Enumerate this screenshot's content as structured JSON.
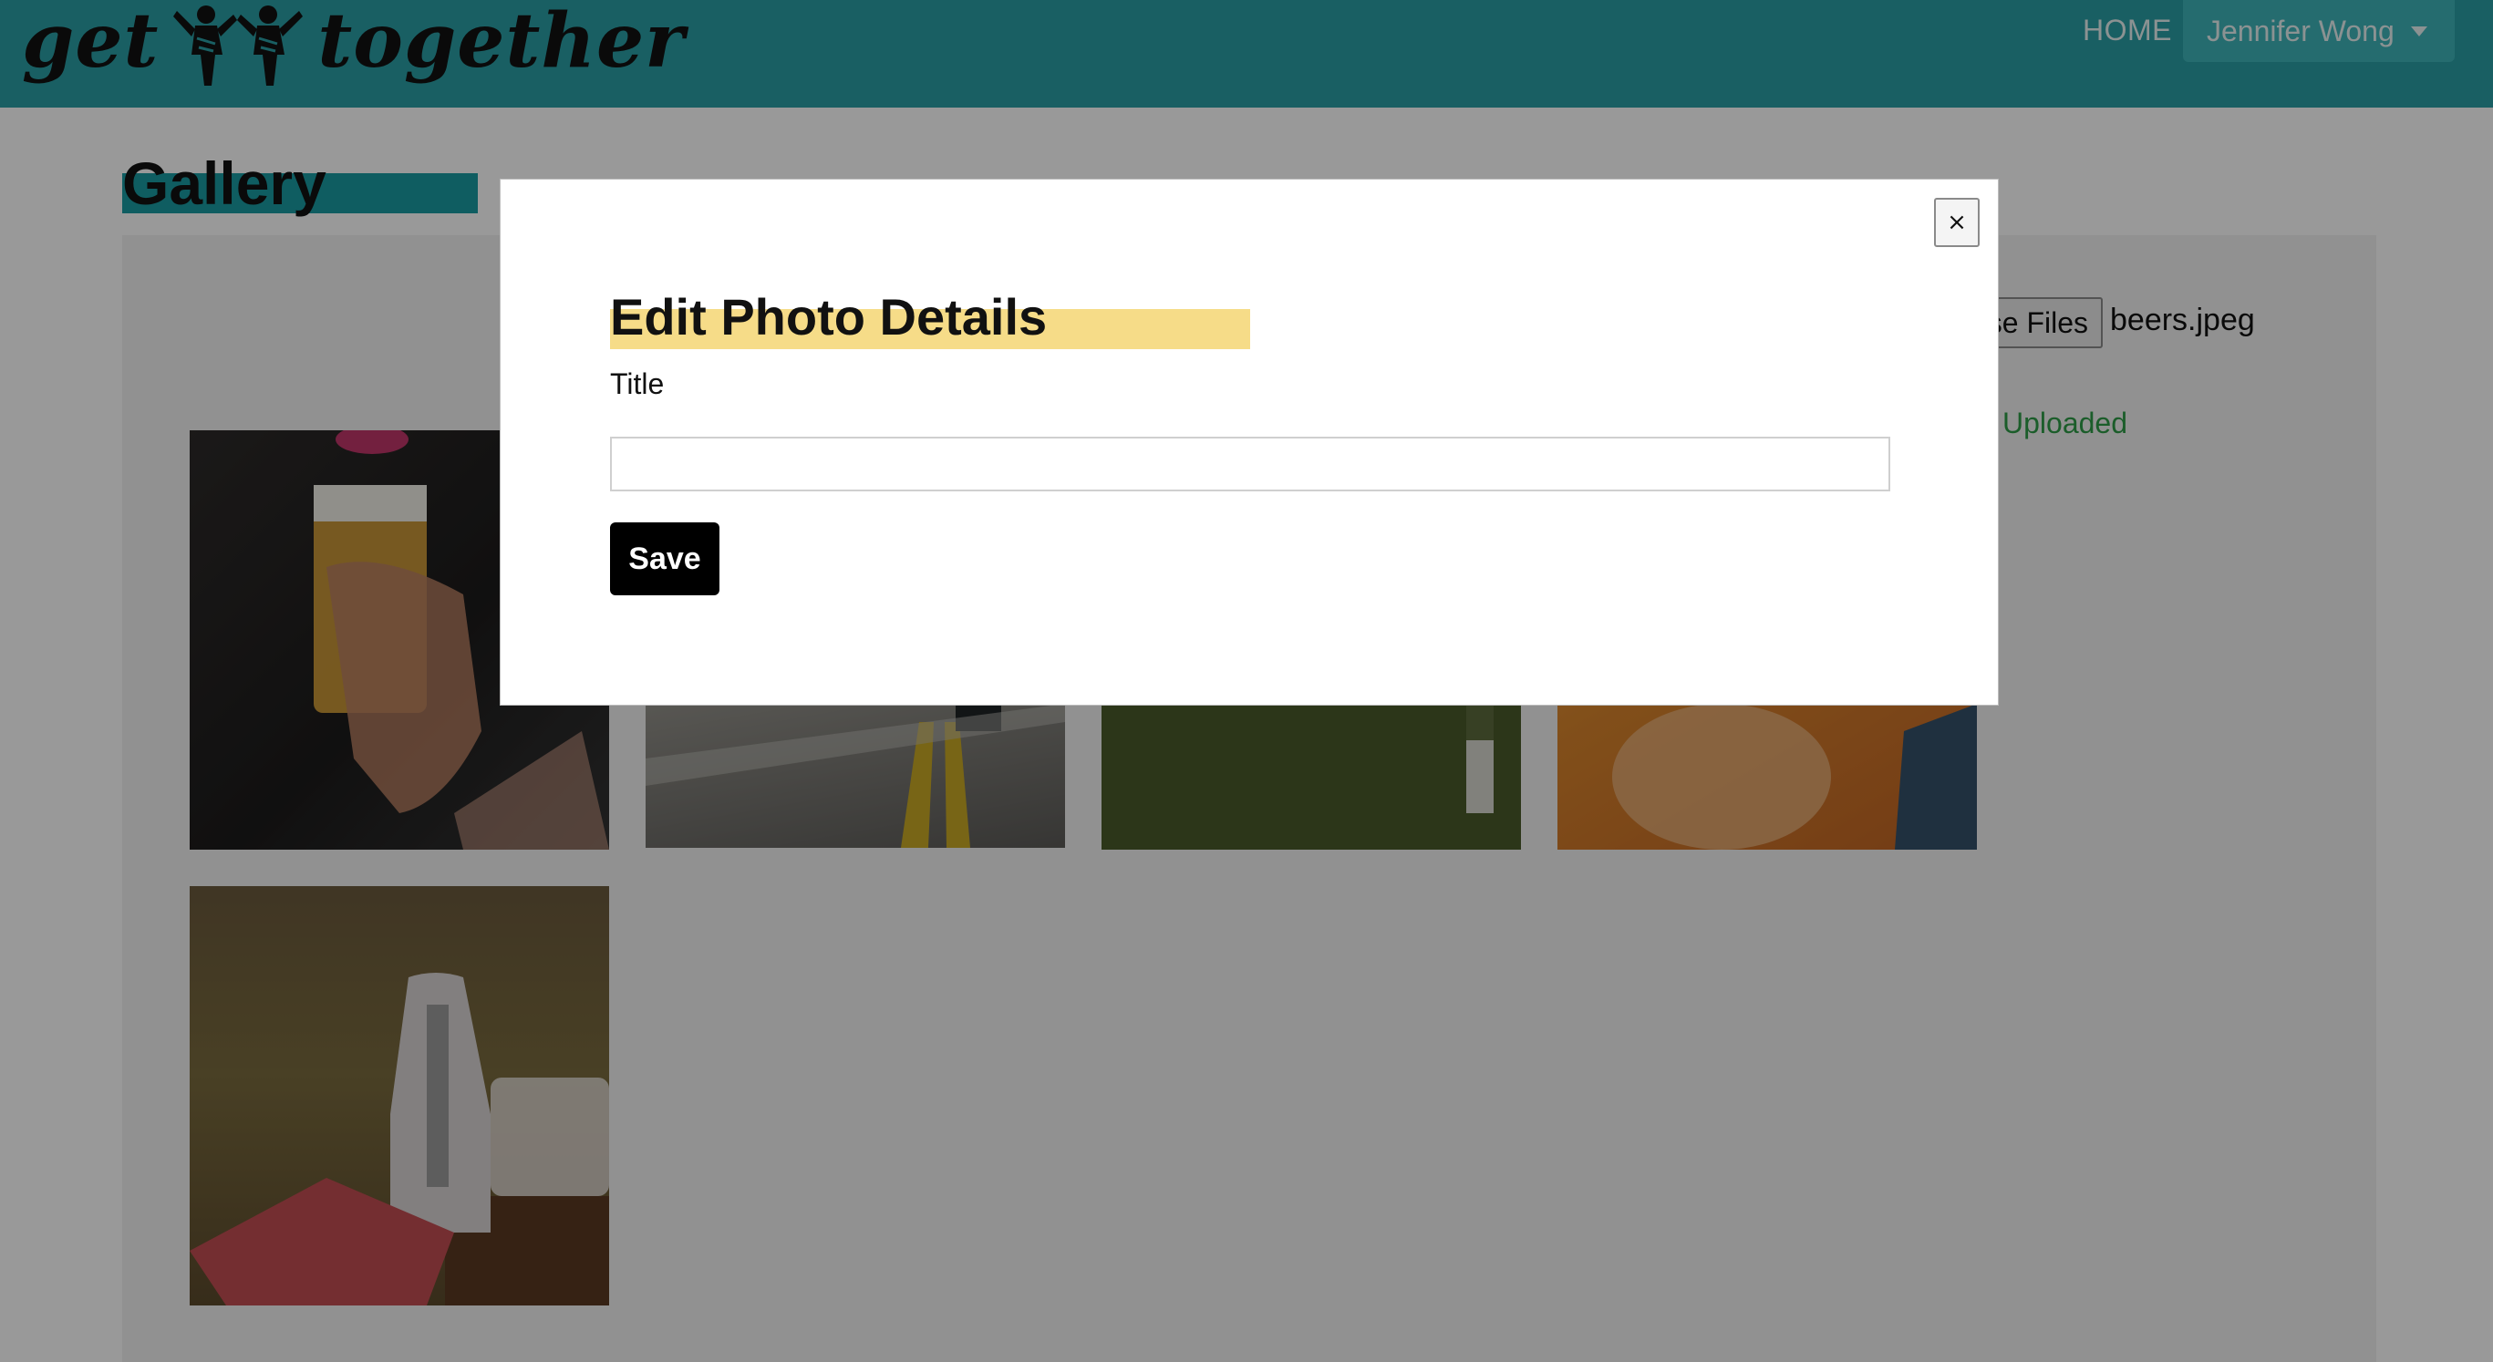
{
  "navbar": {
    "logo_left": "get",
    "logo_right": "together",
    "logo_icon": "people-figures-icon",
    "home_label": "HOME",
    "user_name": "Jennifer Wong",
    "user_caret_icon": "caret-down-icon",
    "background_color": "#2b9fa5"
  },
  "page": {
    "title": "Gallery",
    "title_highlight_color": "#1a9ba2",
    "file_button_label": "se Files",
    "file_name": "beers.jpeg",
    "upload_status": "Uploaded"
  },
  "gallery": {
    "photos": [
      {
        "name": "photo-beer"
      },
      {
        "name": "photo-road"
      },
      {
        "name": "photo-dog"
      },
      {
        "name": "photo-sunset"
      },
      {
        "name": "photo-picnic"
      }
    ]
  },
  "modal": {
    "title": "Edit Photo Details",
    "title_highlight_color": "#f6dc88",
    "field_label": "Title",
    "title_input_value": "",
    "save_label": "Save",
    "close_label": "×"
  }
}
